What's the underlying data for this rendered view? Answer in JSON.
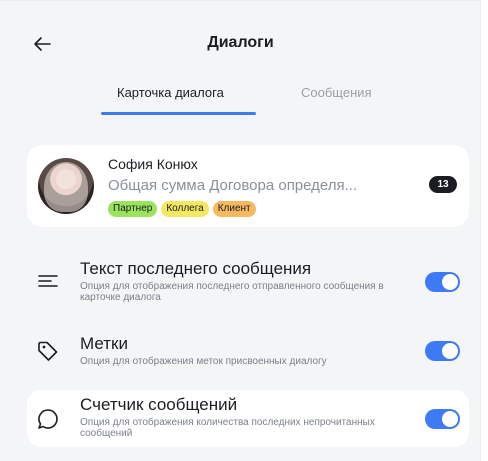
{
  "header": {
    "title": "Диалоги"
  },
  "tabs": [
    {
      "label": "Карточка диалога",
      "active": true
    },
    {
      "label": "Сообщения",
      "active": false
    }
  ],
  "preview": {
    "name": "София Конюх",
    "message": "Общая сумма Договора определя...",
    "tags": [
      "Партнер",
      "Коллега",
      "Клиент"
    ],
    "unread_count": "13"
  },
  "settings": [
    {
      "title": "Текст последнего сообщения",
      "description": "Опция для отображения последнего отправленного сообщения в карточке диалога",
      "enabled": true,
      "icon": "text-lines-icon"
    },
    {
      "title": "Метки",
      "description": "Опция для отображения меток присвоенных диалогу",
      "enabled": true,
      "icon": "tag-icon"
    },
    {
      "title": "Счетчик сообщений",
      "description": "Опция для отображения количества последних непрочитанных сообщений",
      "enabled": true,
      "icon": "chat-bubble-icon"
    }
  ],
  "colors": {
    "accent": "#3d7bf5",
    "background": "#f4f5f7",
    "tag_green": "#9be35c",
    "tag_yellow": "#f3e862",
    "tag_orange": "#f7b85f"
  }
}
